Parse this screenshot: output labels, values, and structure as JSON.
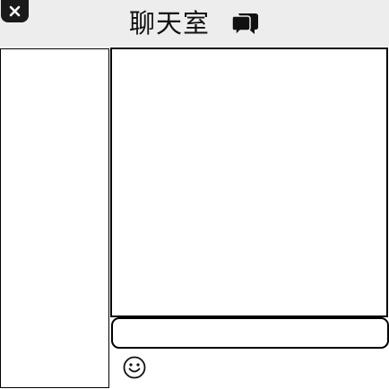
{
  "window": {
    "title": "聊天室"
  },
  "titlebar": {
    "close_icon": "close-icon",
    "chat_icon": "chat-bubbles-icon"
  },
  "contacts": {
    "items": []
  },
  "messages": {
    "items": []
  },
  "composer": {
    "input_value": "",
    "input_placeholder": "",
    "emoji_icon": "smiley-icon"
  },
  "colors": {
    "titlebar_background": "#ededed",
    "close_button": "#1a1a1a",
    "border": "#000000",
    "background": "#ffffff"
  }
}
